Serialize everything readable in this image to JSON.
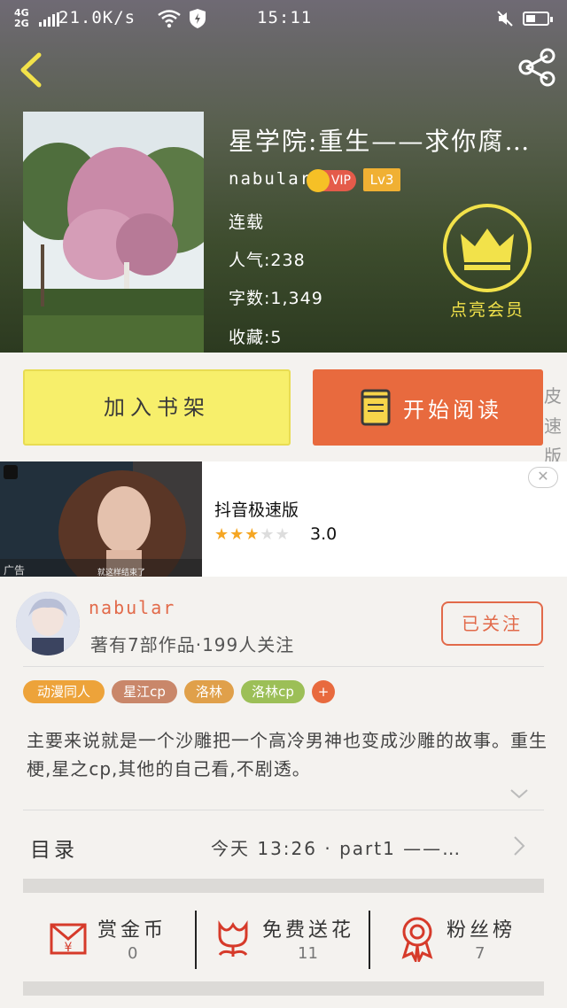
{
  "status_bar": {
    "network": "4G 2G",
    "speed": "21.0K/s",
    "time": "15:11"
  },
  "book": {
    "title": "星学院:重生——求你腐…",
    "author": "nabular",
    "vip_label": "VIP",
    "level": "Lv3",
    "status": "连载",
    "popularity": "人气:238",
    "word_count": "字数:1,349",
    "favorites": "收藏:5",
    "vip_action": "点亮会员"
  },
  "actions": {
    "add_shelf": "加入书架",
    "start_read": "开始阅读",
    "edge_text": "皮 速版"
  },
  "ad": {
    "app_name": "抖音极速版",
    "rating": "3.0",
    "rating_value": 3,
    "rating_max": 5,
    "tag": "广告",
    "caption": "就这样结束了"
  },
  "author_card": {
    "name": "nabular",
    "stats": "著有7部作品·199人关注",
    "follow_label": "已关注"
  },
  "tags": [
    {
      "label": "动漫同人",
      "color": "#eda33a"
    },
    {
      "label": "星江cp",
      "color": "#c9876a"
    },
    {
      "label": "洛林",
      "color": "#e0a04a"
    },
    {
      "label": "洛林cp",
      "color": "#9cbf57"
    },
    {
      "label": "+",
      "color": "#e86a3e"
    }
  ],
  "description": "主要来说就是一个沙雕把一个高冷男神也变成沙雕的故事。重生梗,星之cp,其他的自己看,不剧透。",
  "toc": {
    "label": "目录",
    "latest": "今天 13:26 · part1 ——…"
  },
  "stats": [
    {
      "label": "赏金币",
      "value": "0",
      "icon": "red-envelope-icon"
    },
    {
      "label": "免费送花",
      "value": "11",
      "icon": "flower-icon"
    },
    {
      "label": "粉丝榜",
      "value": "7",
      "icon": "medal-icon"
    }
  ],
  "colors": {
    "accent": "#e86a3e",
    "shelf_yellow": "#f7ef6b",
    "crown_yellow": "#f2e24a",
    "author_red": "#e26a4a"
  }
}
